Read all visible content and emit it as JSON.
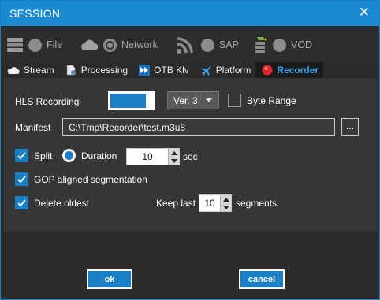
{
  "window": {
    "title": "SESSION",
    "close_glyph": "✕"
  },
  "sources": [
    {
      "label": "File",
      "icon": "storage-icon"
    },
    {
      "label": "Network",
      "icon": "cloud-icon"
    },
    {
      "label": "SAP",
      "icon": "wifi-signal-icon"
    },
    {
      "label": "VOD",
      "icon": "media-library-icon"
    }
  ],
  "tabs": [
    {
      "label": "Stream",
      "icon": "cloud-icon"
    },
    {
      "label": "Processing",
      "icon": "document-gear-icon"
    },
    {
      "label": "OTB Klv",
      "icon": "forward-arrows-icon"
    },
    {
      "label": "Platform",
      "icon": "airplane-icon"
    },
    {
      "label": "Recorder",
      "icon": "record-dot-icon",
      "active": true
    }
  ],
  "recorder": {
    "hls_label": "HLS Recording",
    "hls_enabled": true,
    "version_value": "Ver. 3",
    "byte_range_label": "Byte Range",
    "byte_range_checked": false,
    "manifest_label": "Manifest",
    "manifest_value": "C:\\Tmp\\Recorder\\test.m3u8",
    "browse_label": "...",
    "split_label": "Split",
    "split_checked": true,
    "duration_label": "Duration",
    "duration_value": "10",
    "duration_unit": "sec",
    "gop_label": "GOP aligned segmentation",
    "gop_checked": true,
    "delete_label": "Delete oldest",
    "delete_checked": true,
    "keep_last_label": "Keep last",
    "keep_last_value": "10",
    "segments_label": "segments"
  },
  "buttons": {
    "ok": "ok",
    "cancel": "cancel"
  },
  "colors": {
    "accent": "#1a7fc4",
    "titlebar": "#1c8ad2",
    "active_tab_text": "#3aa3ea",
    "record_red": "#e0262a"
  }
}
